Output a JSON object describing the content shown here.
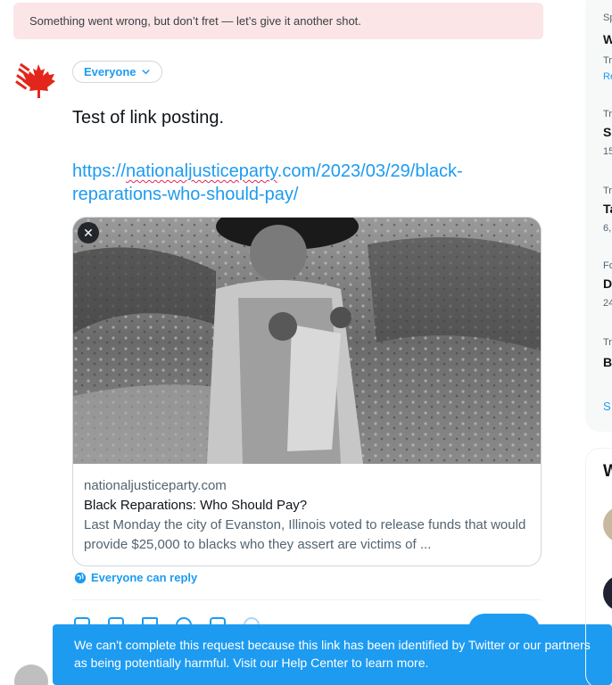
{
  "error_banner": {
    "text": "Something went wrong, but don’t fret — let’s give it another shot."
  },
  "composer": {
    "audience_label": "Everyone",
    "text": "Test of link posting.",
    "link_url": {
      "prefix": "https://",
      "underlined": "nationaljusticeparty",
      "suffix": ".com/2023/03/29/black-reparations-who-should-pay/"
    },
    "link_card": {
      "domain": "nationaljusticeparty.com",
      "title": "Black Reparations: Who Should Pay?",
      "description": "Last Monday the city of Evanston, Illinois voted to release funds that would provide $25,000 to blacks who they assert are victims of ..."
    },
    "reply_setting": "Everyone can reply"
  },
  "toast": {
    "text": "We can't complete this request because this link has been identified by Twitter or our partners as being potentially harmful. Visit our Help Center to learn more."
  },
  "right_column": {
    "trend_lines": [
      {
        "text": "Sp",
        "style": "meta"
      },
      {
        "text": "W",
        "style": "strong"
      },
      {
        "text": "Tr",
        "style": "meta"
      },
      {
        "text": "Re",
        "style": "blue"
      },
      {
        "text": "Tr",
        "style": "meta"
      },
      {
        "text": "S",
        "style": "strong"
      },
      {
        "text": "15",
        "style": "meta"
      },
      {
        "text": "Tr",
        "style": "meta"
      },
      {
        "text": "Ta",
        "style": "strong"
      },
      {
        "text": "6,",
        "style": "meta"
      },
      {
        "text": "Fo",
        "style": "meta"
      },
      {
        "text": "D",
        "style": "strong"
      },
      {
        "text": "24",
        "style": "meta"
      },
      {
        "text": "Tr",
        "style": "meta"
      },
      {
        "text": "B",
        "style": "strong"
      },
      {
        "text": "S",
        "style": "blue"
      }
    ],
    "who_to_follow_title": "W"
  },
  "colors": {
    "accent": "#1d9bf0",
    "error_bg": "#fbe5e7",
    "logo_red": "#e3261b"
  },
  "icons": [
    "maple-leaf-logo",
    "chevron-down-icon",
    "close-icon",
    "globe-icon",
    "image-icon",
    "gif-icon",
    "poll-icon",
    "emoji-icon",
    "schedule-icon",
    "location-icon"
  ]
}
